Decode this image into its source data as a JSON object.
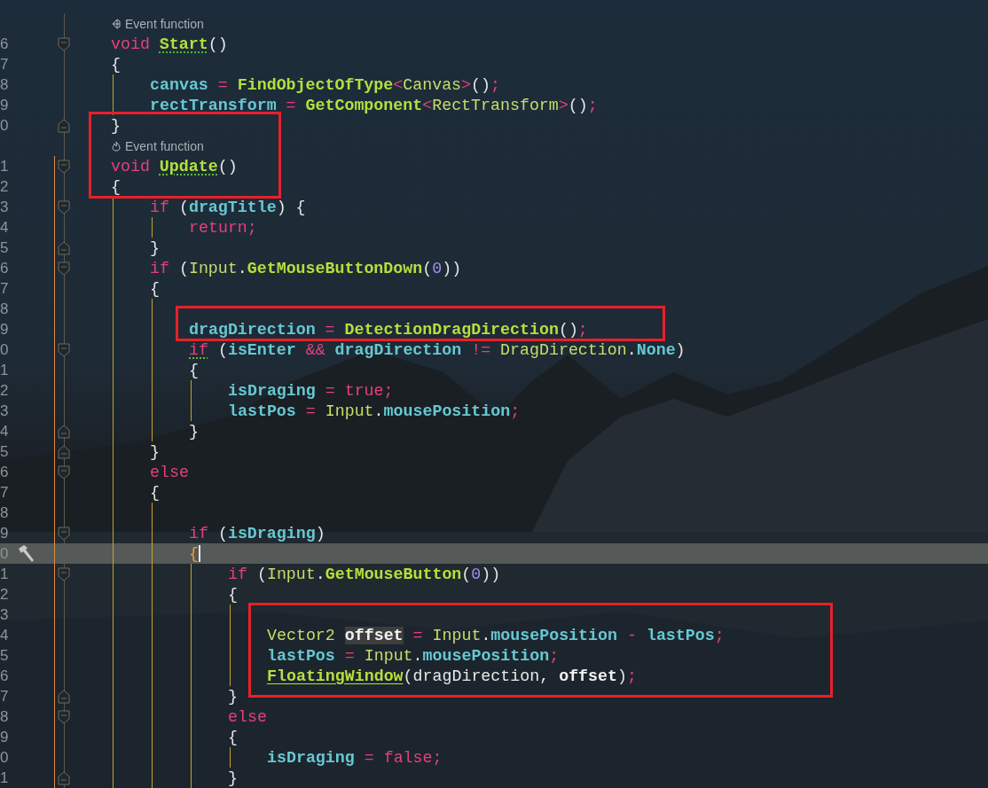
{
  "editor": {
    "rows": [
      {
        "kind": "hint",
        "text": "Event function"
      },
      {
        "kind": "code",
        "number": "6",
        "fold_start": true,
        "tokens": [
          {
            "text": "void ",
            "kind": "keyword"
          },
          {
            "text": "Start",
            "kind": "method",
            "squiggle": true
          },
          {
            "text": "()",
            "kind": "punct"
          }
        ]
      },
      {
        "kind": "code",
        "number": "7",
        "tokens": [
          {
            "text": "{",
            "kind": "punct"
          }
        ],
        "children": [
          {
            "kind": "code",
            "number": "8",
            "tokens": [
              {
                "text": "canvas",
                "kind": "field"
              },
              {
                "text": " = ",
                "kind": "op"
              },
              {
                "text": "FindObjectOfType",
                "kind": "method"
              },
              {
                "text": "<",
                "kind": "op"
              },
              {
                "text": "Canvas",
                "kind": "type"
              },
              {
                "text": ">",
                "kind": "op"
              },
              {
                "text": "()",
                "kind": "punct"
              },
              {
                "text": ";",
                "kind": "op"
              }
            ]
          },
          {
            "kind": "code",
            "number": "9",
            "tokens": [
              {
                "text": "rectTransform",
                "kind": "field"
              },
              {
                "text": " = ",
                "kind": "op"
              },
              {
                "text": "GetComponent",
                "kind": "method"
              },
              {
                "text": "<",
                "kind": "op"
              },
              {
                "text": "RectTransform",
                "kind": "type"
              },
              {
                "text": ">",
                "kind": "op"
              },
              {
                "text": "()",
                "kind": "punct"
              },
              {
                "text": ";",
                "kind": "op"
              }
            ]
          }
        ]
      },
      {
        "kind": "code",
        "number": "0",
        "fold_end": true,
        "tokens": [
          {
            "text": "}",
            "kind": "punct"
          }
        ]
      },
      {
        "kind": "hint",
        "text": "Event function"
      },
      {
        "kind": "code",
        "number": "1",
        "fold_start": true,
        "current_scope": true,
        "tokens": [
          {
            "text": "void ",
            "kind": "keyword"
          },
          {
            "text": "Update",
            "kind": "method",
            "squiggle": true
          },
          {
            "text": "()",
            "kind": "punct"
          }
        ]
      },
      {
        "kind": "code",
        "number": "2",
        "current_scope": true,
        "tokens": [
          {
            "text": "{",
            "kind": "punct"
          }
        ],
        "children": [
          {
            "kind": "code",
            "number": "3",
            "fold_start": true,
            "tokens": [
              {
                "text": "if ",
                "kind": "keyword"
              },
              {
                "text": "(",
                "kind": "punct"
              },
              {
                "text": "dragTitle",
                "kind": "field"
              },
              {
                "text": ") {",
                "kind": "punct"
              }
            ],
            "children": [
              {
                "kind": "code",
                "number": "4",
                "tokens": [
                  {
                    "text": "return",
                    "kind": "keyword"
                  },
                  {
                    "text": ";",
                    "kind": "op"
                  }
                ]
              }
            ]
          },
          {
            "kind": "code",
            "number": "5",
            "fold_end": true,
            "tokens": [
              {
                "text": "}",
                "kind": "punct"
              }
            ]
          },
          {
            "kind": "code",
            "number": "6",
            "fold_start": true,
            "tokens": [
              {
                "text": "if ",
                "kind": "keyword"
              },
              {
                "text": "(",
                "kind": "punct"
              },
              {
                "text": "Input",
                "kind": "type"
              },
              {
                "text": ".",
                "kind": "punct"
              },
              {
                "text": "GetMouseButtonDown",
                "kind": "method"
              },
              {
                "text": "(",
                "kind": "punct"
              },
              {
                "text": "0",
                "kind": "number"
              },
              {
                "text": "))",
                "kind": "punct"
              }
            ]
          },
          {
            "kind": "code",
            "number": "7",
            "tokens": [
              {
                "text": "{",
                "kind": "punct"
              }
            ],
            "children": [
              {
                "kind": "code",
                "number": "8"
              },
              {
                "kind": "code",
                "number": "9",
                "tokens": [
                  {
                    "text": "dragDirection",
                    "kind": "field"
                  },
                  {
                    "text": " = ",
                    "kind": "op"
                  },
                  {
                    "text": "DetectionDragDirection",
                    "kind": "method"
                  },
                  {
                    "text": "()",
                    "kind": "punct"
                  },
                  {
                    "text": ";",
                    "kind": "op"
                  }
                ]
              },
              {
                "kind": "code",
                "number": "0",
                "fold_start": true,
                "tokens": [
                  {
                    "text": "if",
                    "kind": "keyword",
                    "squiggle": true
                  },
                  {
                    "text": " (",
                    "kind": "punct"
                  },
                  {
                    "text": "isEnter",
                    "kind": "field"
                  },
                  {
                    "text": " && ",
                    "kind": "op"
                  },
                  {
                    "text": "dragDirection",
                    "kind": "field"
                  },
                  {
                    "text": " != ",
                    "kind": "op"
                  },
                  {
                    "text": "DragDirection",
                    "kind": "type"
                  },
                  {
                    "text": ".",
                    "kind": "punct"
                  },
                  {
                    "text": "None",
                    "kind": "field"
                  },
                  {
                    "text": ")",
                    "kind": "punct"
                  }
                ]
              },
              {
                "kind": "code",
                "number": "1",
                "tokens": [
                  {
                    "text": "{",
                    "kind": "punct"
                  }
                ],
                "children": [
                  {
                    "kind": "code",
                    "number": "2",
                    "tokens": [
                      {
                        "text": "isDraging",
                        "kind": "field"
                      },
                      {
                        "text": " = ",
                        "kind": "op"
                      },
                      {
                        "text": "true",
                        "kind": "keyword"
                      },
                      {
                        "text": ";",
                        "kind": "op"
                      }
                    ]
                  },
                  {
                    "kind": "code",
                    "number": "3",
                    "tokens": [
                      {
                        "text": "lastPos",
                        "kind": "field"
                      },
                      {
                        "text": " = ",
                        "kind": "op"
                      },
                      {
                        "text": "Input",
                        "kind": "type"
                      },
                      {
                        "text": ".",
                        "kind": "punct"
                      },
                      {
                        "text": "mousePosition",
                        "kind": "field"
                      },
                      {
                        "text": ";",
                        "kind": "op"
                      }
                    ]
                  }
                ]
              },
              {
                "kind": "code",
                "number": "4",
                "fold_end": true,
                "tokens": [
                  {
                    "text": "}",
                    "kind": "punct"
                  }
                ]
              }
            ]
          },
          {
            "kind": "code",
            "number": "5",
            "fold_end": true,
            "tokens": [
              {
                "text": "}",
                "kind": "punct"
              }
            ]
          },
          {
            "kind": "code",
            "number": "6",
            "fold_start": true,
            "tokens": [
              {
                "text": "else",
                "kind": "keyword"
              }
            ]
          },
          {
            "kind": "code",
            "number": "7",
            "tokens": [
              {
                "text": "{",
                "kind": "punct"
              }
            ],
            "children": [
              {
                "kind": "code",
                "number": "8"
              },
              {
                "kind": "code",
                "number": "9",
                "fold_start": true,
                "tokens": [
                  {
                    "text": "if ",
                    "kind": "keyword"
                  },
                  {
                    "text": "(",
                    "kind": "punct"
                  },
                  {
                    "text": "isDraging",
                    "kind": "field"
                  },
                  {
                    "text": ")",
                    "kind": "punct"
                  }
                ]
              },
              {
                "kind": "code",
                "number": "0",
                "current": true,
                "caret": true,
                "tokens": [
                  {
                    "text": "{",
                    "kind": "brace_match"
                  }
                ],
                "children": [
                  {
                    "kind": "code",
                    "number": "1",
                    "fold_start": true,
                    "tokens": [
                      {
                        "text": "if ",
                        "kind": "keyword"
                      },
                      {
                        "text": "(",
                        "kind": "punct"
                      },
                      {
                        "text": "Input",
                        "kind": "type"
                      },
                      {
                        "text": ".",
                        "kind": "punct"
                      },
                      {
                        "text": "GetMouseButton",
                        "kind": "method"
                      },
                      {
                        "text": "(",
                        "kind": "punct"
                      },
                      {
                        "text": "0",
                        "kind": "number"
                      },
                      {
                        "text": "))",
                        "kind": "punct"
                      }
                    ]
                  },
                  {
                    "kind": "code",
                    "number": "2",
                    "tokens": [
                      {
                        "text": "{",
                        "kind": "punct"
                      }
                    ],
                    "children": [
                      {
                        "kind": "code",
                        "number": "3"
                      },
                      {
                        "kind": "code",
                        "number": "4",
                        "tokens": [
                          {
                            "text": "Vector2 ",
                            "kind": "type"
                          },
                          {
                            "text": "offset",
                            "kind": "local",
                            "highlight": true
                          },
                          {
                            "text": " = ",
                            "kind": "op"
                          },
                          {
                            "text": "Input",
                            "kind": "type"
                          },
                          {
                            "text": ".",
                            "kind": "punct"
                          },
                          {
                            "text": "mousePosition",
                            "kind": "field"
                          },
                          {
                            "text": " - ",
                            "kind": "op"
                          },
                          {
                            "text": "lastPos",
                            "kind": "field"
                          },
                          {
                            "text": ";",
                            "kind": "op"
                          }
                        ]
                      },
                      {
                        "kind": "code",
                        "number": "5",
                        "tokens": [
                          {
                            "text": "lastPos",
                            "kind": "field"
                          },
                          {
                            "text": " = ",
                            "kind": "op"
                          },
                          {
                            "text": "Input",
                            "kind": "type"
                          },
                          {
                            "text": ".",
                            "kind": "punct"
                          },
                          {
                            "text": "mousePosition",
                            "kind": "field"
                          },
                          {
                            "text": ";",
                            "kind": "op"
                          }
                        ]
                      },
                      {
                        "kind": "code",
                        "number": "6",
                        "tokens": [
                          {
                            "text": "FloatingWindow",
                            "kind": "method",
                            "underline": true
                          },
                          {
                            "text": "(",
                            "kind": "punct"
                          },
                          {
                            "text": "dragDirection",
                            "kind": "param"
                          },
                          {
                            "text": ", ",
                            "kind": "punct"
                          },
                          {
                            "text": "offset",
                            "kind": "local"
                          },
                          {
                            "text": ")",
                            "kind": "punct"
                          },
                          {
                            "text": ";",
                            "kind": "op"
                          }
                        ]
                      }
                    ]
                  },
                  {
                    "kind": "code",
                    "number": "7",
                    "fold_end": true,
                    "tokens": [
                      {
                        "text": "}",
                        "kind": "punct"
                      }
                    ]
                  },
                  {
                    "kind": "code",
                    "number": "8",
                    "fold_start": true,
                    "tokens": [
                      {
                        "text": "else",
                        "kind": "keyword"
                      }
                    ]
                  },
                  {
                    "kind": "code",
                    "number": "9",
                    "tokens": [
                      {
                        "text": "{",
                        "kind": "punct"
                      }
                    ],
                    "children": [
                      {
                        "kind": "code",
                        "number": "0",
                        "tokens": [
                          {
                            "text": "isDraging",
                            "kind": "field"
                          },
                          {
                            "text": " = ",
                            "kind": "op"
                          },
                          {
                            "text": "false",
                            "kind": "keyword"
                          },
                          {
                            "text": ";",
                            "kind": "op"
                          }
                        ]
                      }
                    ]
                  },
                  {
                    "kind": "code",
                    "number": "1",
                    "fold_end": true,
                    "tokens": [
                      {
                        "text": "}",
                        "kind": "punct"
                      }
                    ]
                  }
                ]
              }
            ]
          }
        ]
      }
    ]
  }
}
